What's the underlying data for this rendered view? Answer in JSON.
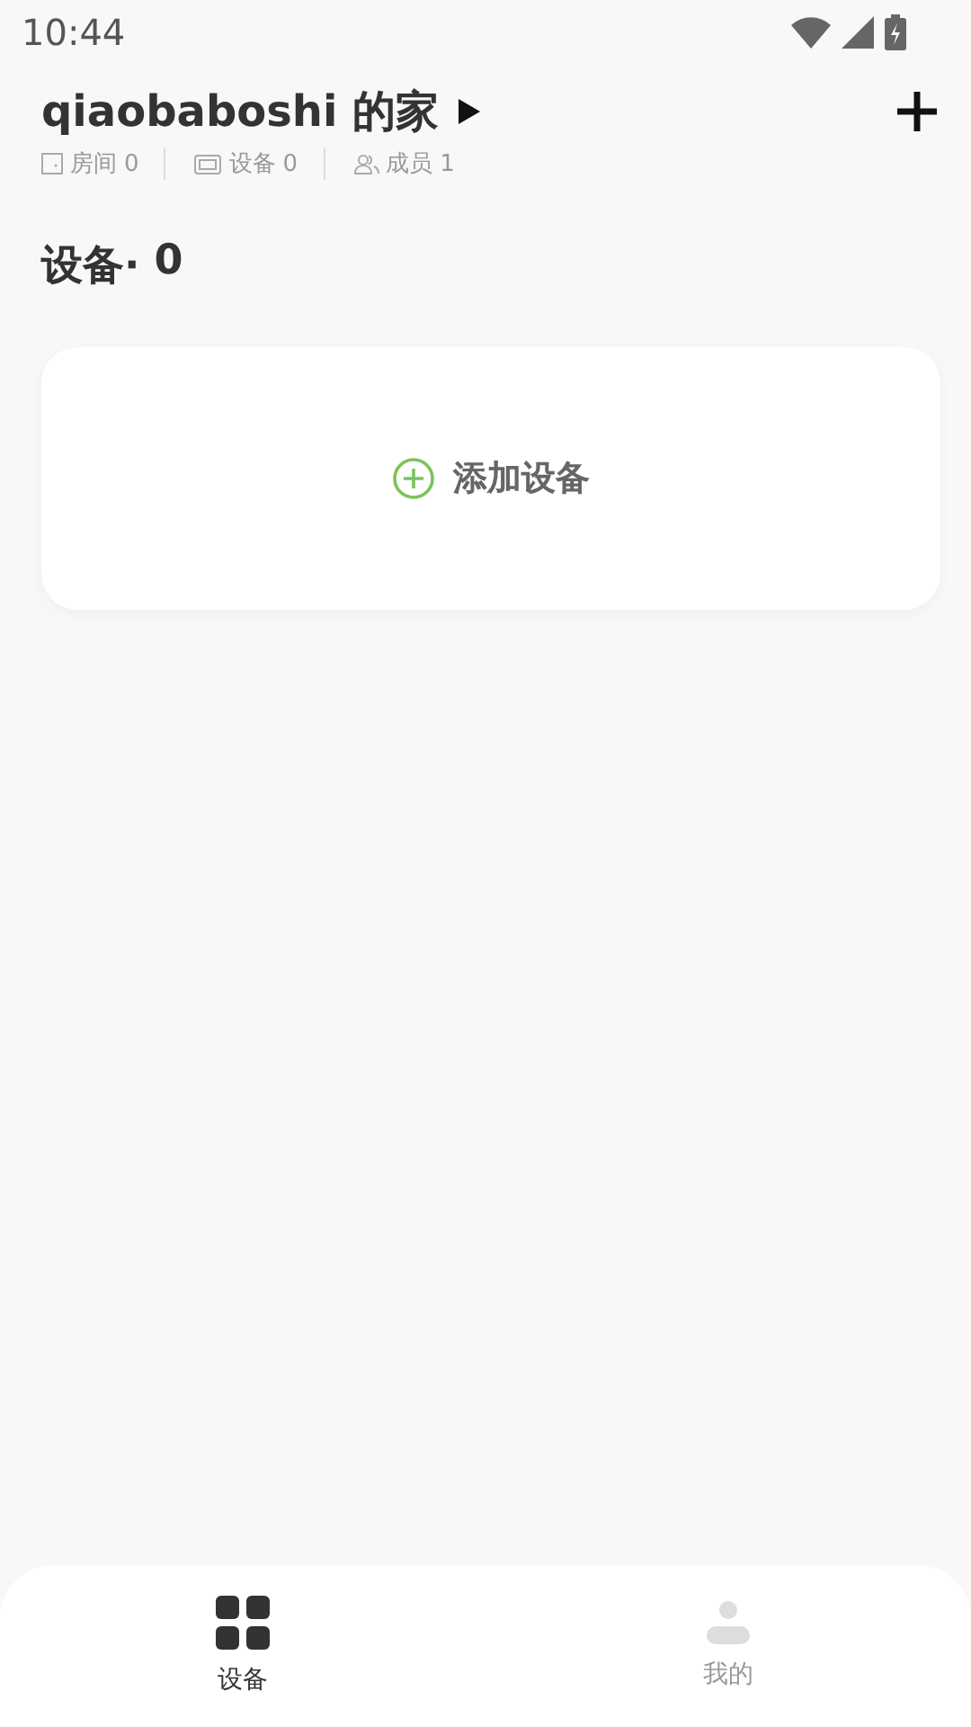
{
  "status_bar": {
    "time": "10:44"
  },
  "header": {
    "title": "qiaobaboshi 的家",
    "stats": [
      {
        "kind": "room",
        "label": "房间",
        "count": "0"
      },
      {
        "kind": "device",
        "label": "设备",
        "count": "0"
      },
      {
        "kind": "member",
        "label": "成员",
        "count": "1"
      }
    ]
  },
  "section": {
    "title": "设备·",
    "count": "0"
  },
  "add_card": {
    "label": "添加设备"
  },
  "tabs": [
    {
      "kind": "devices",
      "label": "设备",
      "selected": true
    },
    {
      "kind": "me",
      "label": "我的",
      "selected": false
    }
  ]
}
